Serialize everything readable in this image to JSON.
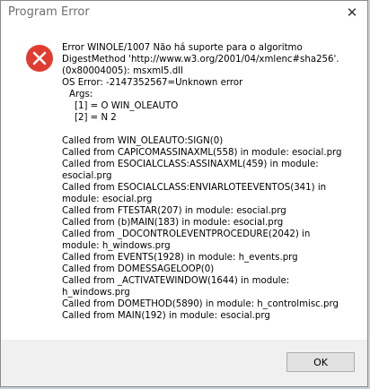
{
  "window": {
    "title": "Program Error",
    "close_glyph": "✕"
  },
  "icon": {
    "name": "error-icon",
    "color": "#e03c31"
  },
  "message": {
    "lines": [
      "Error WINOLE/1007  Não há suporte para o algoritmo",
      "DigestMethod 'http://www.w3.org/2001/04/xmlenc#sha256'.",
      "(0x80004005): msxml5.dll",
      "OS Error: -2147352567=Unknown error",
      "Args:",
      "[1] = O    WIN_OLEAUTO",
      "[2] = N   2",
      "",
      "Called from WIN_OLEAUTO:SIGN(0)",
      "Called from CAPICOMASSINAXML(558) in module: esocial.prg",
      "Called from ESOCIALCLASS:ASSINAXML(459) in module:",
      "esocial.prg",
      "Called from ESOCIALCLASS:ENVIARLOTEEVENTOS(341) in",
      "module: esocial.prg",
      "Called from FTESTAR(207) in module: esocial.prg",
      "Called from (b)MAIN(183) in module: esocial.prg",
      "Called from _DOCONTROLEVENTPROCEDURE(2042) in",
      "module: h_windows.prg",
      "Called from EVENTS(1928) in module: h_events.prg",
      "Called from DOMESSAGELOOP(0)",
      "Called from _ACTIVATEWINDOW(1644) in module:",
      "h_windows.prg",
      "Called from DOMETHOD(5890) in module: h_controlmisc.prg",
      "Called from MAIN(192) in module: esocial.prg"
    ]
  },
  "buttons": {
    "ok_label": "OK"
  }
}
